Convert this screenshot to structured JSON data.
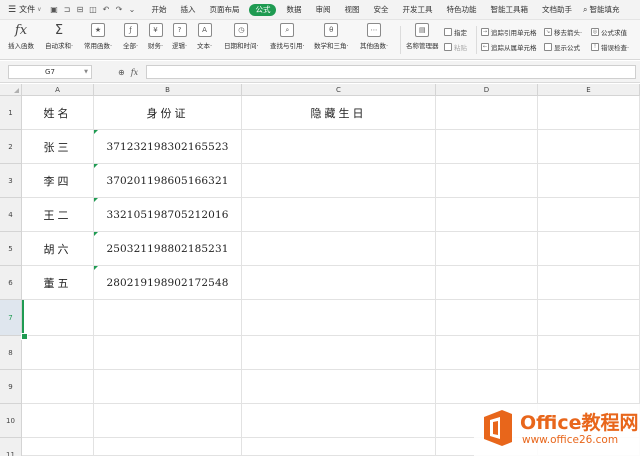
{
  "menubar": {
    "file_label": "文件",
    "tabs": [
      {
        "label": "开始",
        "active": false
      },
      {
        "label": "插入",
        "active": false
      },
      {
        "label": "页面布局",
        "active": false
      },
      {
        "label": "公式",
        "active": true
      },
      {
        "label": "数据",
        "active": false
      },
      {
        "label": "审阅",
        "active": false
      },
      {
        "label": "视图",
        "active": false
      },
      {
        "label": "安全",
        "active": false
      },
      {
        "label": "开发工具",
        "active": false
      },
      {
        "label": "特色功能",
        "active": false
      },
      {
        "label": "智能工具箱",
        "active": false
      },
      {
        "label": "文档助手",
        "active": false
      }
    ],
    "search_label": "智能填充",
    "accent_color": "#1f9b52"
  },
  "ribbon": {
    "buttons": [
      {
        "label": "插入函数",
        "icon": "fx-icon"
      },
      {
        "label": "自动求和·",
        "icon": "sigma-icon"
      },
      {
        "label": "常用函数·",
        "icon": "function-icon"
      },
      {
        "label": "全部·",
        "icon": "function-icon"
      },
      {
        "label": "财务·",
        "icon": "function-icon"
      },
      {
        "label": "逻辑·",
        "icon": "function-icon"
      },
      {
        "label": "文本·",
        "icon": "function-icon"
      },
      {
        "label": "日期和时间·",
        "icon": "function-icon"
      },
      {
        "label": "查找与引用·",
        "icon": "function-icon"
      },
      {
        "label": "数学和三角·",
        "icon": "function-icon"
      },
      {
        "label": "其他函数·",
        "icon": "function-icon"
      },
      {
        "label": "名称管理器",
        "icon": "name-manager-icon"
      }
    ],
    "small": {
      "specify": "指定",
      "paste": "粘贴",
      "trace_precedents": "追踪引用单元格",
      "trace_dependents": "追踪从属单元格",
      "remove_arrows": "移去箭头·",
      "show_formulas": "显示公式",
      "formula_eval": "公式求值",
      "error_check": "错误检查·"
    }
  },
  "formula_bar": {
    "cell_ref": "G7",
    "fx_label": "fx",
    "value": ""
  },
  "sheet": {
    "columns": [
      "A",
      "B",
      "C",
      "D",
      "E"
    ],
    "rows": [
      "1",
      "2",
      "3",
      "4",
      "5",
      "6",
      "7",
      "8",
      "9",
      "10",
      "11"
    ],
    "headers": {
      "name": "姓名",
      "id": "身份证",
      "birth": "隐藏生日"
    },
    "records": [
      {
        "name": "张三",
        "id": "371232198302165523"
      },
      {
        "name": "李四",
        "id": "370201198605166321"
      },
      {
        "name": "王二",
        "id": "332105198705212016"
      },
      {
        "name": "胡六",
        "id": "250321198802185231"
      },
      {
        "name": "董五",
        "id": "280219198902172548"
      }
    ]
  },
  "watermark": {
    "title": "Office教程网",
    "url": "www.office26.com"
  }
}
